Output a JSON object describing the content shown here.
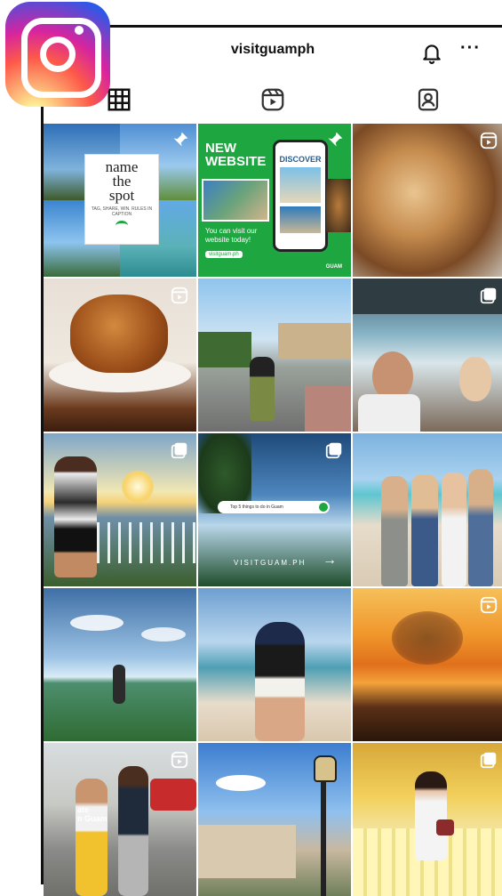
{
  "profile": {
    "username": "visitguamph"
  },
  "header": {
    "more_label": "···"
  },
  "posts": {
    "p1": {
      "title": "name\nthe\nspot",
      "subtitle": "TAG, SHARE, WIN. RULES IN CAPTION"
    },
    "p2": {
      "headline": "NEW\nWEBSITE",
      "body": "You can visit our website today!",
      "url": "visitguam.ph",
      "phone_heading": "DISCOVER",
      "brand": "GUAM"
    },
    "p8": {
      "search_text": "Top 5 things to do in Guam",
      "footer": "VISITGUAM.PH"
    },
    "p13": {
      "overlay": "ate\nn Guam"
    }
  },
  "colors": {
    "accent_green": "#1ea640",
    "text": "#111111"
  },
  "icons": [
    "instagram-logo-icon",
    "bell-icon",
    "more-icon",
    "grid-icon",
    "reels-icon",
    "tagged-icon",
    "reel-badge-icon",
    "carousel-badge-icon",
    "pin-icon"
  ]
}
